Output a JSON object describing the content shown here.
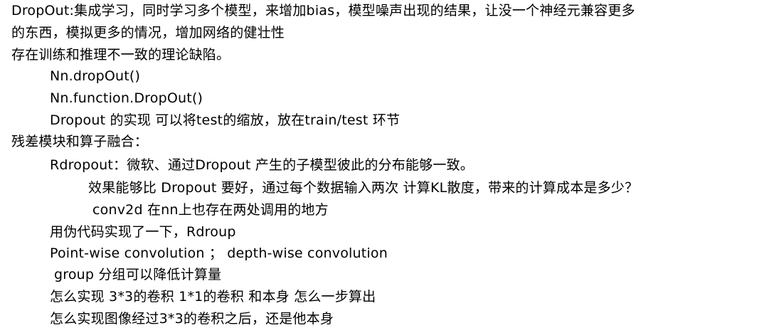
{
  "note": {
    "lines": [
      "DropOut:集成学习，同时学习多个模型，来增加bias，模型噪声出现的结果，让没一个神经元兼容更多",
      "的东西，模拟更多的情况，增加网络的健壮性",
      "存在训练和推理不一致的理论缺陷。",
      "Nn.dropOut()",
      "Nn.function.DropOut()",
      "Dropout 的实现 可以将test的缩放，放在train/test 环节",
      "残差模块和算子融合：",
      "Rdropout：微软、通过Dropout 产生的子模型彼此的分布能够一致。",
      "效果能够比 Dropout 要好，通过每个数据输入两次 计算KL散度，带来的计算成本是多少？",
      "conv2d 在nn上也存在两处调用的地方",
      "用伪代码实现了一下，Rdroup",
      "Point-wise convolution ； depth-wise convolution",
      "group 分组可以降低计算量",
      "怎么实现 3*3的卷积 1*1的卷积 和本身 怎么一步算出",
      "怎么实现图像经过3*3的卷积之后，还是他本身"
    ]
  }
}
